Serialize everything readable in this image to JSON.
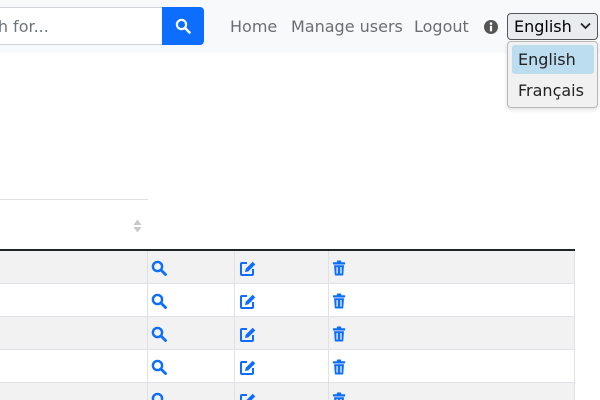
{
  "search": {
    "placeholder": "Search for..."
  },
  "nav": {
    "links": [
      "Home",
      "Manage users",
      "Logout"
    ]
  },
  "language": {
    "selected": "English",
    "options": [
      "English",
      "Français"
    ]
  },
  "table": {
    "rows": [
      {
        "actions": [
          "search-icon",
          "edit-icon",
          "trash-icon"
        ]
      },
      {
        "actions": [
          "search-icon",
          "edit-icon",
          "trash-icon"
        ]
      },
      {
        "actions": [
          "search-icon",
          "edit-icon",
          "trash-icon"
        ]
      },
      {
        "actions": [
          "search-icon",
          "edit-icon",
          "trash-icon"
        ]
      },
      {
        "actions": [
          "search-icon",
          "edit-icon",
          "trash-icon"
        ]
      }
    ]
  },
  "colors": {
    "primary": "#0d6efd",
    "navbar_bg": "#f8f9fa",
    "nav_link": "#6b6e71",
    "row_stripe": "#f2f2f2",
    "dropdown_highlight": "#bcdcf0"
  }
}
